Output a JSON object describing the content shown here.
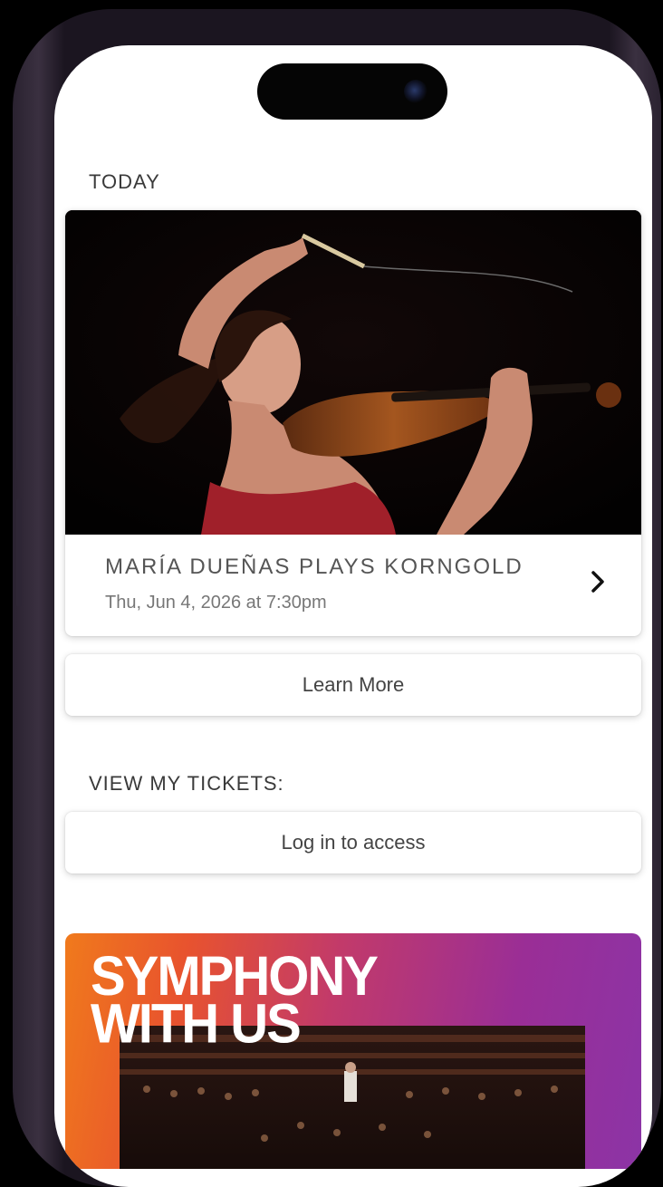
{
  "today_label": "TODAY",
  "event": {
    "title": "MARÍA DUEÑAS PLAYS KORNGOLD",
    "datetime": "Thu, Jun 4, 2026 at 7:30pm",
    "image_icon": "violinist-photo",
    "chevron_icon": "chevron-right-icon"
  },
  "learn_more_label": "Learn More",
  "tickets_label": "VIEW MY TICKETS:",
  "login_label": "Log in to access",
  "promo": {
    "title": "SYMPHONY\nWITH US",
    "image_icon": "orchestra-photo",
    "colors": [
      "#f07a1c",
      "#c23a6a",
      "#8c34a6"
    ]
  }
}
